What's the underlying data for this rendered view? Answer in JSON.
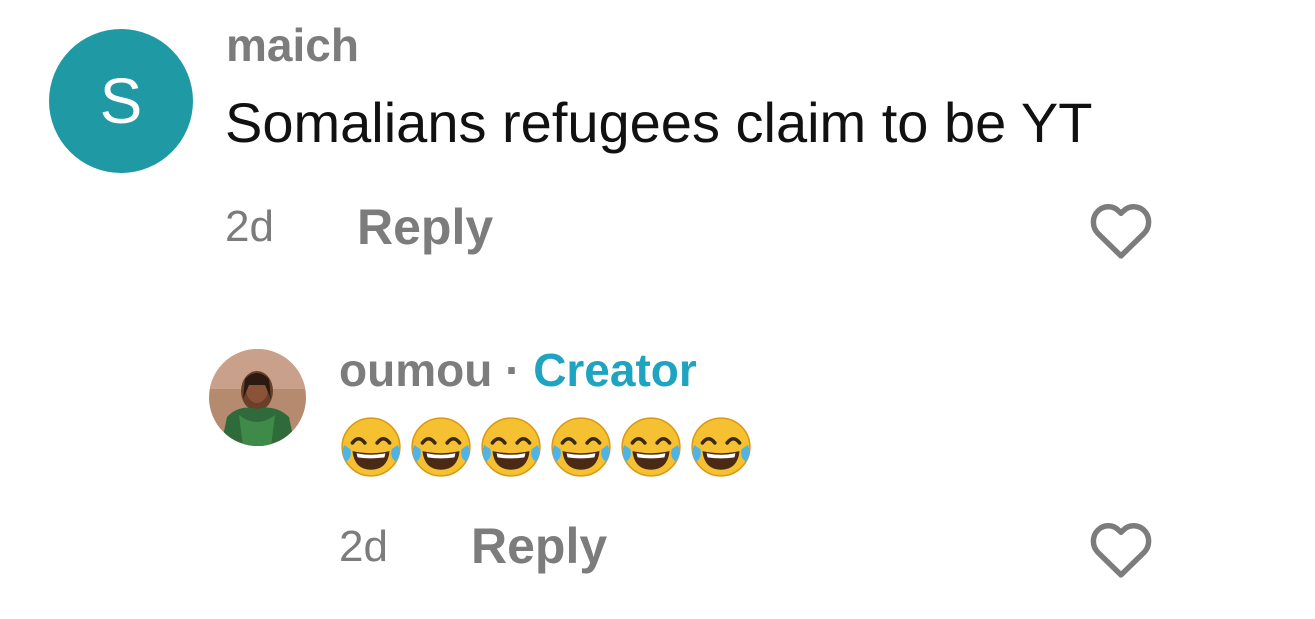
{
  "colors": {
    "avatar_bg": "#1f9aa5",
    "creator_accent": "#1ea3c1",
    "muted_text": "#7c7c7c"
  },
  "comments": [
    {
      "avatar_letter": "S",
      "username": "maich",
      "text": "Somalians refugees claim to be YT",
      "time": "2d",
      "reply_label": "Reply",
      "like_icon": "heart-outline-icon"
    },
    {
      "avatar_icon": "user-photo",
      "username": "oumou",
      "separator": "·",
      "badge": "Creator",
      "text_emojis": [
        "😂",
        "😂",
        "😂",
        "😂",
        "😂",
        "😂"
      ],
      "time": "2d",
      "reply_label": "Reply",
      "like_icon": "heart-outline-icon"
    }
  ]
}
